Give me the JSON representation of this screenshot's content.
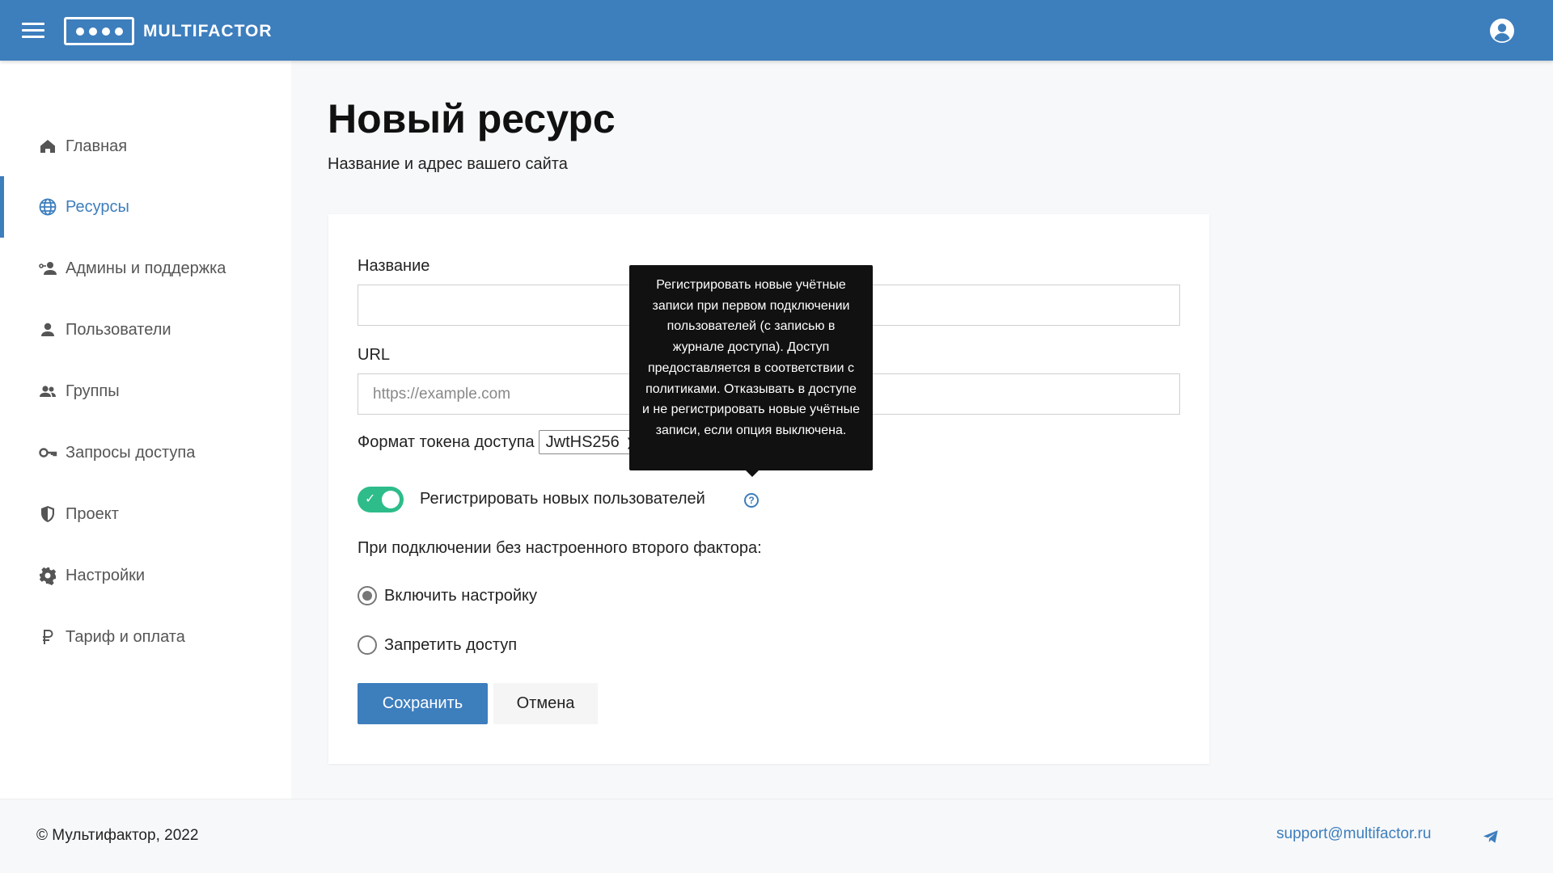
{
  "header": {
    "app_name": "MULTIFACTOR",
    "menu_icon": "hamburger-menu-icon",
    "account_icon": "user-account-icon"
  },
  "sidebar": {
    "items": [
      {
        "label": "Главная",
        "icon": "home-icon"
      },
      {
        "label": "Ресурсы",
        "icon": "globe-icon",
        "active": true
      },
      {
        "label": "Админы и поддержка",
        "icon": "admin-support-icon"
      },
      {
        "label": "Пользователи",
        "icon": "user-icon"
      },
      {
        "label": "Группы",
        "icon": "group-icon"
      },
      {
        "label": "Запросы доступа",
        "icon": "key-icon"
      },
      {
        "label": "Проект",
        "icon": "shield-icon"
      },
      {
        "label": "Настройки",
        "icon": "gear-icon"
      },
      {
        "label": "Тариф и оплата",
        "icon": "ruble-icon"
      }
    ]
  },
  "main": {
    "title": "Новый ресурс",
    "subtitle": "Название и адрес вашего сайта",
    "form": {
      "name_label": "Название",
      "name_value": "",
      "url_label": "URL",
      "url_placeholder": "https://example.com",
      "url_value": "",
      "token_format_label": "Формат токена доступа",
      "token_format_value": "JwtHS256",
      "register_toggle_label": "Регистрировать новых пользователей",
      "register_toggle_on": true,
      "no_second_factor_label": "При подключении без настроенного второго фактора:",
      "radio_enable_setup": "Включить настройку",
      "radio_deny_access": "Запретить доступ",
      "selected_radio": "Включить настройку",
      "save_button": "Сохранить",
      "cancel_button": "Отмена"
    },
    "tooltip": {
      "text": "Регистрировать новые учётные записи при первом подключении пользователей (с записью в журнале доступа). Доступ предоставляется в соответствии с политиками. Отказывать в доступе и не регистрировать новые учётные записи, если опция выключена."
    }
  },
  "footer": {
    "copyright": "© Мультифактор, 2022",
    "support_email": "support@multifactor.ru",
    "telegram_icon": "telegram-icon"
  },
  "colors": {
    "brand": "#3d7ebd",
    "toggle_on": "#2dbc8a"
  }
}
